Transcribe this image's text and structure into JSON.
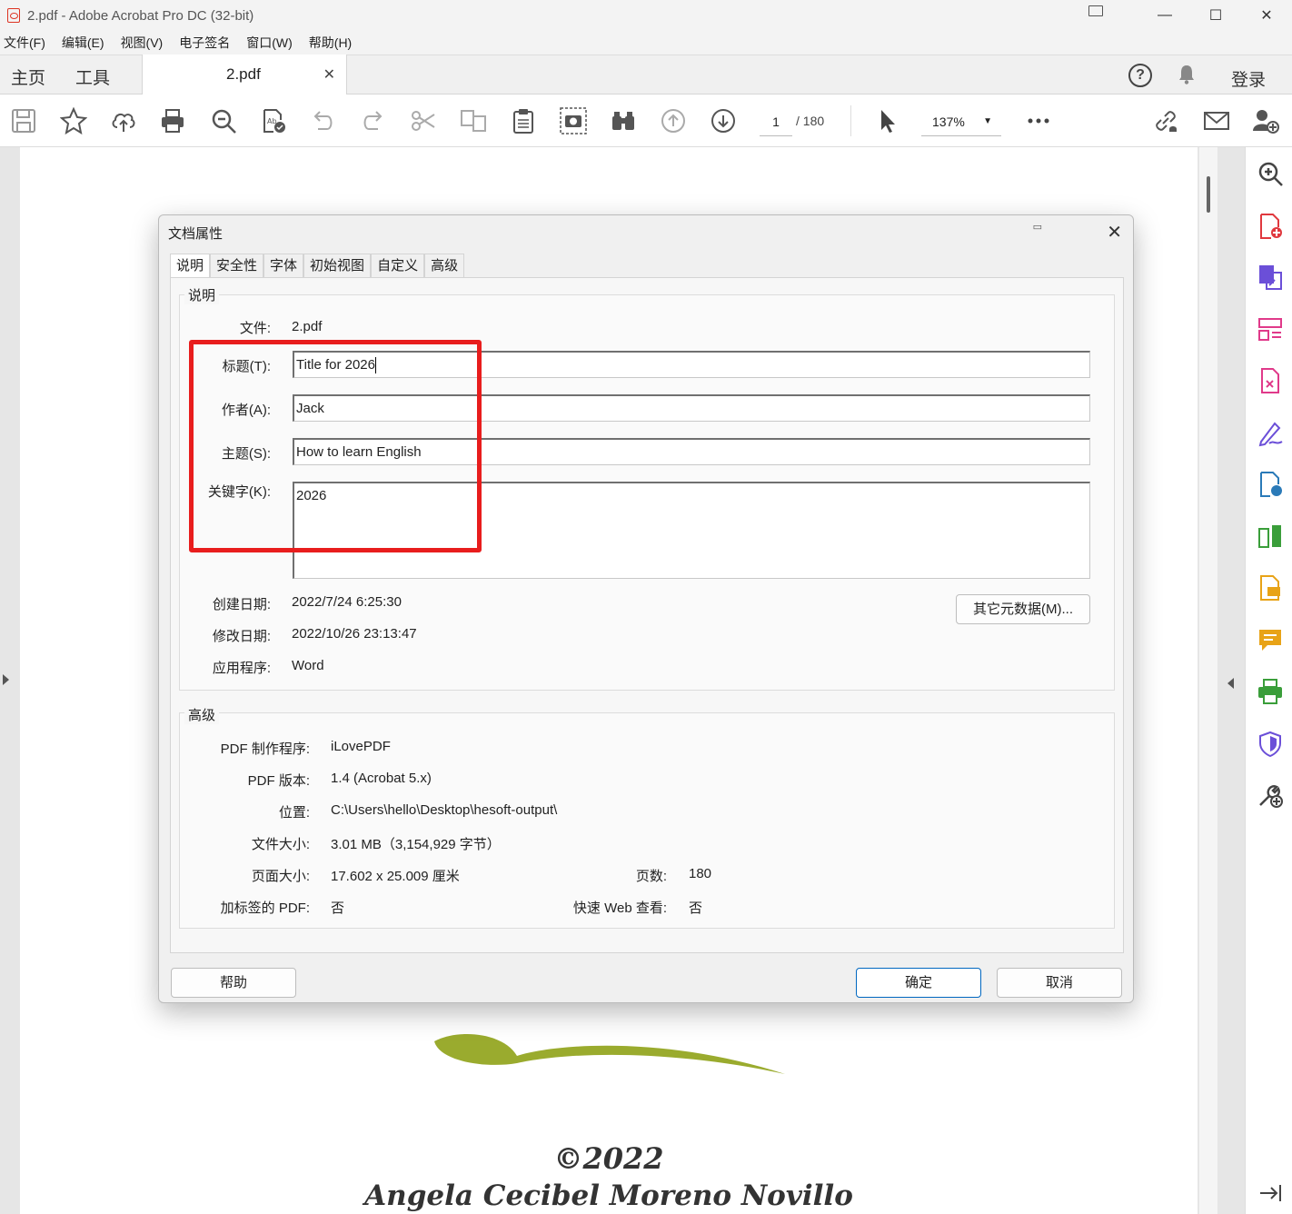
{
  "window": {
    "title": "2.pdf - Adobe Acrobat Pro DC (32-bit)",
    "minimize": "—",
    "maximize": "☐",
    "close": "✕"
  },
  "menu": [
    "文件(F)",
    "编辑(E)",
    "视图(V)",
    "电子签名",
    "窗口(W)",
    "帮助(H)"
  ],
  "tabs": {
    "home": "主页",
    "tools": "工具",
    "document": "2.pdf",
    "help": "?",
    "login": "登录"
  },
  "toolbar": {
    "page_current": "1",
    "page_total": "/ 180",
    "zoom": "137%",
    "icons": [
      "save-icon",
      "star-icon",
      "upload-cloud-icon",
      "print-icon",
      "search-zoom-icon",
      "spellcheck-icon",
      "undo-icon",
      "redo-icon",
      "cut-icon",
      "compare-icon",
      "clipboard-icon",
      "snapshot-icon",
      "binoculars-icon",
      "page-up-icon",
      "page-down-icon",
      "select-arrow-icon",
      "more-icon",
      "link-icon",
      "mail-icon",
      "add-user-icon"
    ]
  },
  "dialog": {
    "title": "文档属性",
    "tabs": [
      "说明",
      "安全性",
      "字体",
      "初始视图",
      "自定义",
      "高级"
    ],
    "description": {
      "group_label": "说明",
      "file_label": "文件:",
      "file_value": "2.pdf",
      "title_label": "标题(T):",
      "title_value": "Title for 2026",
      "author_label": "作者(A):",
      "author_value": "Jack",
      "subject_label": "主题(S):",
      "subject_value": "How to learn English",
      "keywords_label": "关键字(K):",
      "keywords_value": "2026",
      "created_label": "创建日期:",
      "created_value": "2022/7/24 6:25:30",
      "modified_label": "修改日期:",
      "modified_value": "2022/10/26 23:13:47",
      "app_label": "应用程序:",
      "app_value": "Word",
      "metadata_button": "其它元数据(M)..."
    },
    "advanced": {
      "group_label": "高级",
      "producer_label": "PDF 制作程序:",
      "producer_value": "iLovePDF",
      "version_label": "PDF 版本:",
      "version_value": "1.4 (Acrobat 5.x)",
      "location_label": "位置:",
      "location_value": "C:\\Users\\hello\\Desktop\\hesoft-output\\",
      "filesize_label": "文件大小:",
      "filesize_value": "3.01 MB（3,154,929 字节）",
      "pagesize_label": "页面大小:",
      "pagesize_value": "17.602 x 25.009 厘米",
      "pages_label": "页数:",
      "pages_value": "180",
      "tagged_label": "加标签的 PDF:",
      "tagged_value": "否",
      "fastweb_label": "快速 Web 查看:",
      "fastweb_value": "否"
    },
    "buttons": {
      "help": "帮助",
      "ok": "确定",
      "cancel": "取消"
    }
  },
  "page": {
    "copyright": "©2022",
    "author": "Angela Cecibel Moreno Novillo"
  },
  "colors": {
    "highlight_box": "#e81d1d",
    "primary_button_border": "#0067c0",
    "leaf": "#9aab2e"
  }
}
